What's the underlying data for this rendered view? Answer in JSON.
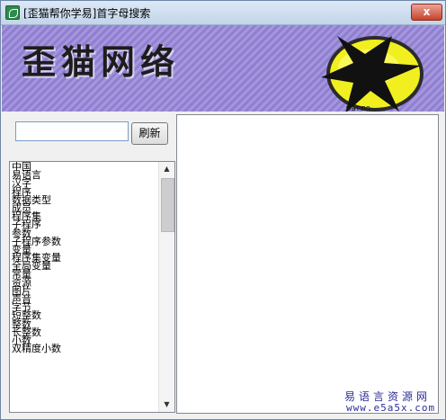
{
  "window": {
    "title": "[歪猫帮你学易]首字母搜索",
    "close_label": "x"
  },
  "banner": {
    "title": "歪猫网络",
    "logo_text": "warmo"
  },
  "search": {
    "value": "",
    "refresh_label": "刷新"
  },
  "list": {
    "items": [
      "中国",
      "易语言",
      "汉字",
      "程序",
      "数据类型",
      "成员",
      "程序集",
      "子程序",
      "参数",
      "子程序参数",
      "变量",
      "程序集变量",
      "全局变量",
      "常量",
      "资源",
      "图片",
      "声音",
      "字节",
      "短整数",
      "整数",
      "长整数",
      "小数",
      "双精度小数"
    ]
  },
  "watermark": {
    "text": "易语言资源网",
    "url": "www.e5a5x.com"
  },
  "colors": {
    "banner_purple": "#9d8fd8",
    "logo_yellow": "#f2ef20",
    "close_red": "#c7432c"
  }
}
